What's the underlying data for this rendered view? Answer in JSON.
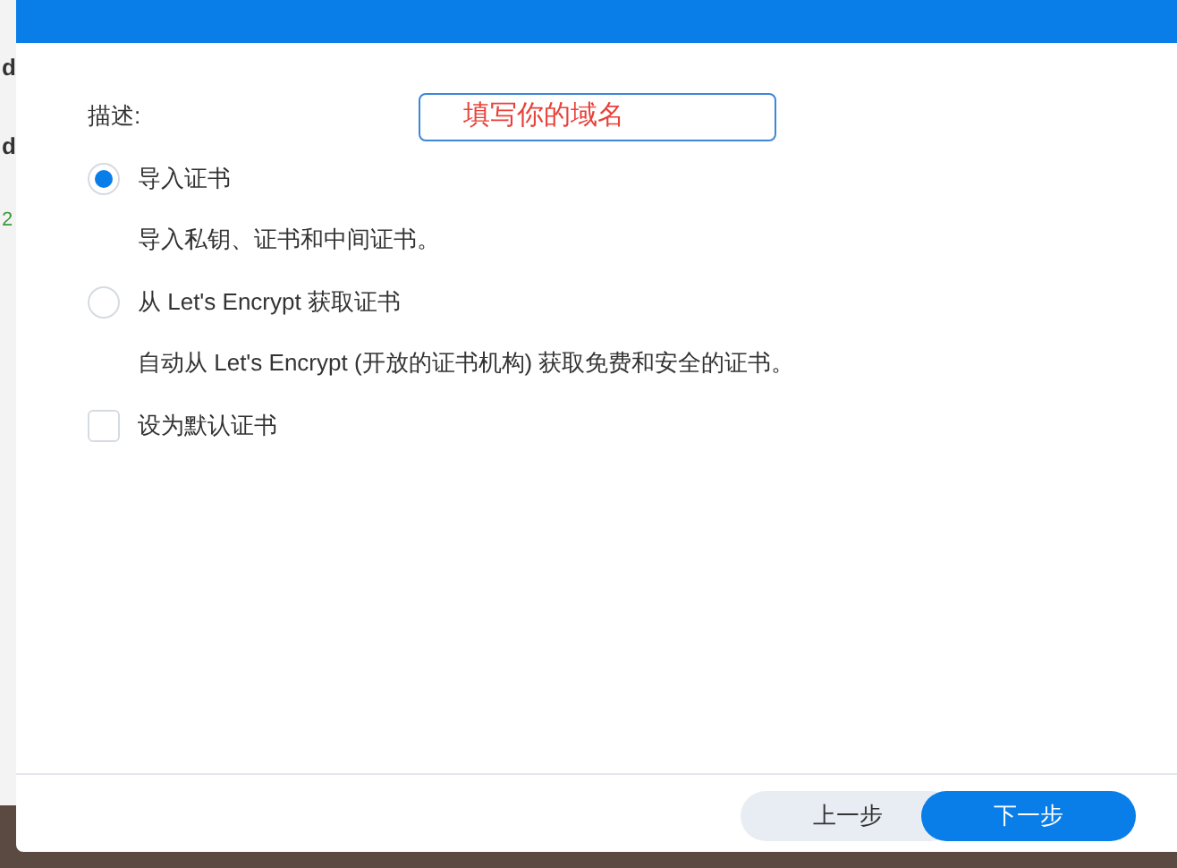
{
  "background_window": {
    "items": [
      {
        "text": "d",
        "kind": "title"
      },
      {
        "text": "d",
        "kind": "title"
      },
      {
        "text": "2",
        "kind": "status"
      }
    ]
  },
  "dialog": {
    "description": {
      "label": "描述:",
      "value": "填写你的域名"
    },
    "options": [
      {
        "kind": "radio",
        "label": "导入证书",
        "selected": true,
        "hint": "导入私钥、证书和中间证书。"
      },
      {
        "kind": "radio",
        "label": "从 Let's Encrypt 获取证书",
        "selected": false,
        "hint": "自动从 Let's Encrypt (开放的证书机构) 获取免费和安全的证书。"
      },
      {
        "kind": "checkbox",
        "label": "设为默认证书",
        "checked": false
      }
    ],
    "buttons": [
      {
        "label": "上一步",
        "kind": "secondary"
      },
      {
        "label": "下一步",
        "kind": "primary"
      }
    ]
  }
}
